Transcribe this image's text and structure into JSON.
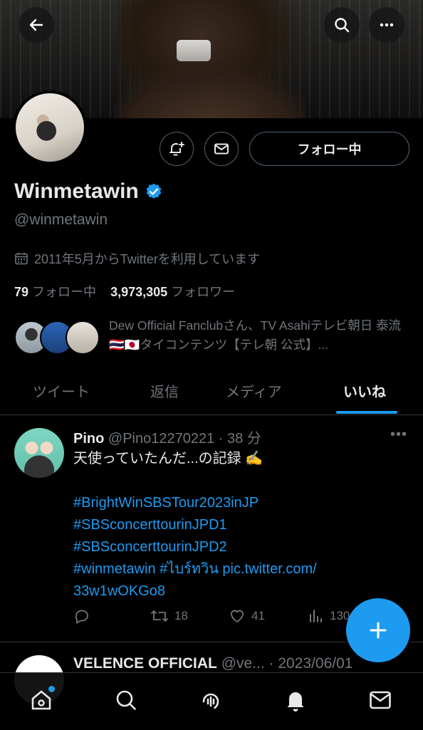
{
  "profile": {
    "name": "Winmetawin",
    "handle": "@winmetawin",
    "joined": "2011年5月からTwitterを利用しています",
    "following_count": "79",
    "following_label": "フォロー中",
    "followers_count": "3,973,305",
    "followers_label": "フォロワー",
    "known_followers": "Dew Official Fanclubさん、TV Asahiテレビ朝日 泰流🇹🇭🇯🇵タイコンテンツ【テレ朝 公式】...",
    "follow_button": "フォロー中"
  },
  "tabs": [
    {
      "label": "ツイート"
    },
    {
      "label": "返信"
    },
    {
      "label": "メディア"
    },
    {
      "label": "いいね"
    }
  ],
  "tweet": {
    "author": "Pino",
    "handle": "@Pino12270221",
    "time": "· 38 分",
    "text": "天使っていたんだ...の記録 ✍️",
    "links": [
      "#BrightWinSBSTour2023inJP",
      "#SBSconcerttourinJPD1",
      "#SBSconcerttourinJPD2",
      "#winmetawin #ไบร์ทวิน pic.twitter.com/",
      "33w1wOKGo8"
    ],
    "retweets": "18",
    "likes": "41",
    "views": "130"
  },
  "tweet2": {
    "author": "VELENCE OFFICIAL",
    "handle": "@ve...",
    "time": "· 2023/06/01"
  },
  "colors": {
    "accent": "#1d9bf0",
    "background": "#000000",
    "text_primary": "#e7e9ea",
    "text_secondary": "#71767b"
  }
}
